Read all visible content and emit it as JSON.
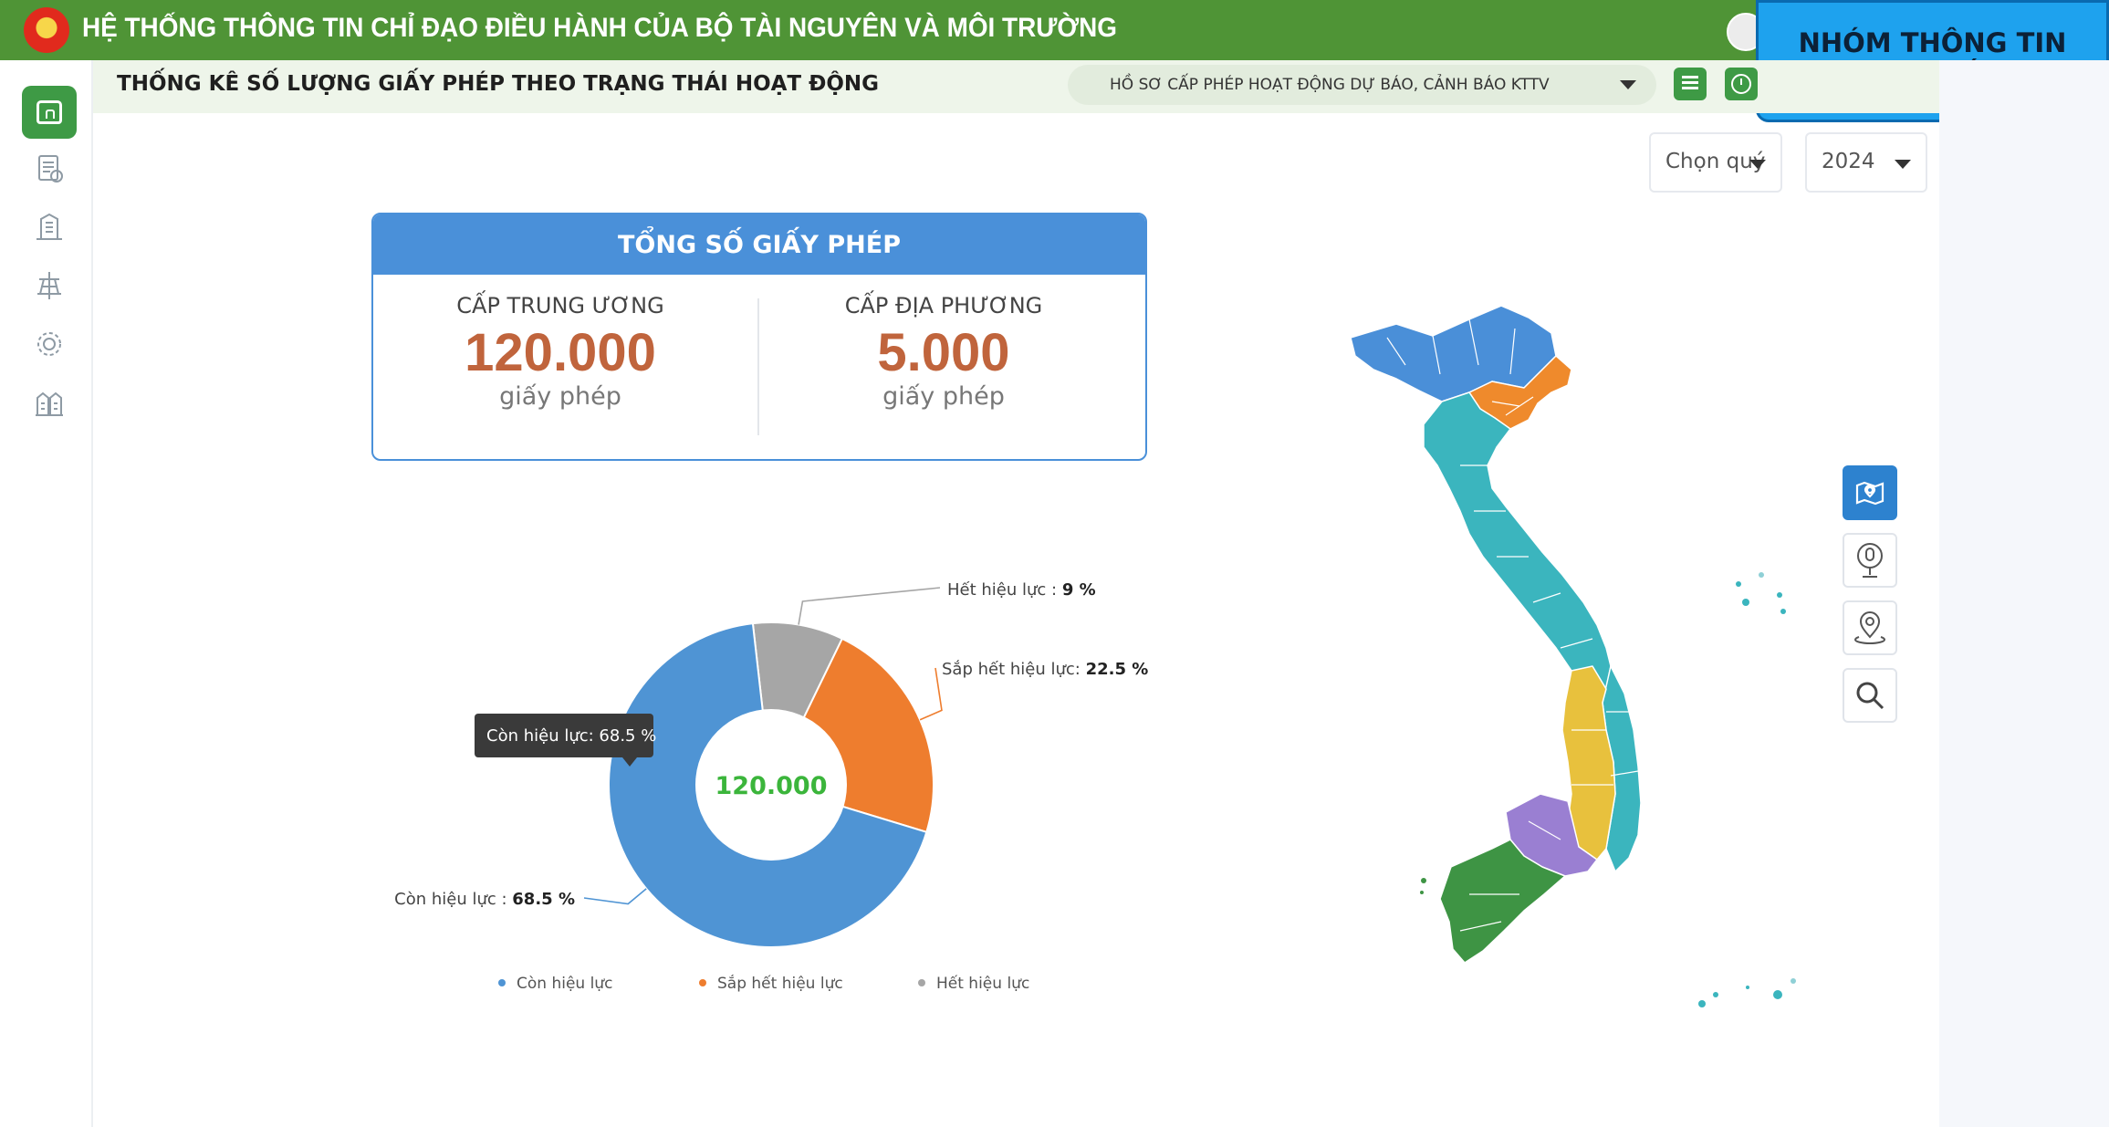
{
  "header": {
    "title": "HỆ THỐNG THÔNG TIN CHỈ ĐẠO ĐIỀU HÀNH CỦA BỘ TÀI NGUYÊN VÀ MÔI TRƯỜNG",
    "badge": "NHÓM THÔNG TIN CHI TIẾT",
    "bar_color": "#4f9436",
    "badge_color": "#1ea2ee"
  },
  "subheader": {
    "page_title": "THỐNG KÊ SỐ LƯỢNG GIẤY PHÉP THEO TRẠNG THÁI HOẠT ĐỘNG",
    "dataset_selected": "HỒ SƠ CẤP PHÉP HOẠT ĐỘNG DỰ BÁO, CẢNH BÁO KTTV"
  },
  "sidebar": {
    "items": [
      {
        "name": "home",
        "icon": "home-icon",
        "active": true
      },
      {
        "name": "documents",
        "icon": "documents-icon",
        "active": false
      },
      {
        "name": "buildings",
        "icon": "buildings-icon",
        "active": false
      },
      {
        "name": "station",
        "icon": "station-icon",
        "active": false
      },
      {
        "name": "settings",
        "icon": "gear-icon",
        "active": false
      },
      {
        "name": "organization",
        "icon": "organization-icon",
        "active": false
      }
    ]
  },
  "filters": {
    "quarter": "Chọn quý",
    "year": "2024"
  },
  "total_card": {
    "title": "TỔNG SỐ GIẤY PHÉP",
    "central_label": "CẤP TRUNG ƯƠNG",
    "central_value": "120.000",
    "central_unit": "giấy phép",
    "local_label": "CẤP ĐỊA PHƯƠNG",
    "local_value": "5.000",
    "local_unit": "giấy phép"
  },
  "chart_data": {
    "type": "pie",
    "donut": true,
    "center_label": "120.000",
    "series": [
      {
        "name": "Còn hiệu lực",
        "value": 68.5,
        "color": "#4f94d4",
        "label_prefix": "Còn hiệu lực : ",
        "label_value": "68.5 %"
      },
      {
        "name": "Sắp hết hiệu lực",
        "value": 22.5,
        "color": "#ee7d2e",
        "label_prefix": "Sắp hết hiệu lực: ",
        "label_value": "22.5 %"
      },
      {
        "name": "Hết hiệu lực",
        "value": 9,
        "color": "#a6a6a6",
        "label_prefix": "Hết hiệu lực : ",
        "label_value": "9 %"
      }
    ],
    "tooltip": "Còn hiệu lực: 68.5 %",
    "legend": [
      "Còn hiệu lực",
      "Sắp hết hiệu lực",
      "Hết hiệu lực"
    ],
    "legend_position": "bottom"
  },
  "map": {
    "region_colors": [
      "#4a8fd8",
      "#ef8a2c",
      "#3bb5be",
      "#e8c13d",
      "#9a7fd2",
      "#3e9444"
    ],
    "tools": [
      "map-pin-icon",
      "mic-pin-icon",
      "location-icon",
      "search-icon"
    ]
  }
}
